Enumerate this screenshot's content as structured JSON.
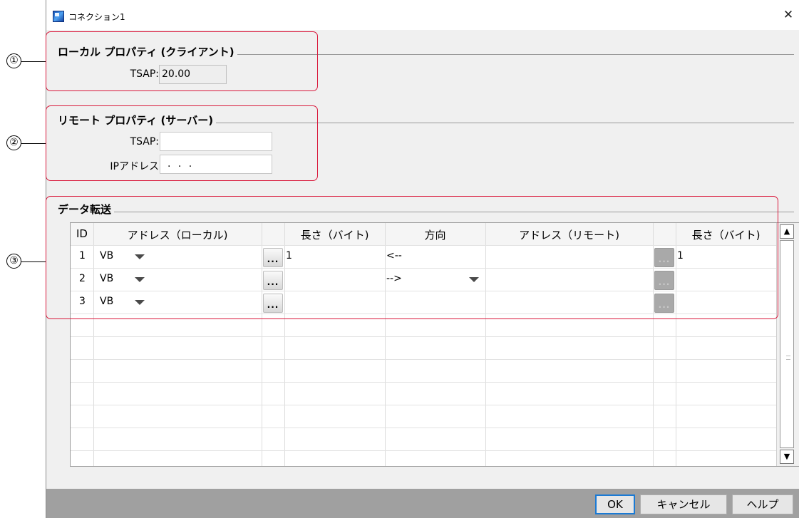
{
  "window": {
    "title": "コネクション1",
    "close_symbol": "✕"
  },
  "callouts": [
    "①",
    "②",
    "③"
  ],
  "local": {
    "group_title": "ローカル プロパティ (クライアント)",
    "tsap_label": "TSAP:",
    "tsap_value": "20.00"
  },
  "remote": {
    "group_title": "リモート プロパティ (サーバー)",
    "tsap_label": "TSAP:",
    "tsap_value": "",
    "ip_label": "IPアドレス",
    "ip_value": " .  .  ."
  },
  "transfer": {
    "group_title": "データ転送",
    "headers": [
      "ID",
      "アドレス（ローカル)",
      "長さ（バイト)",
      "方向",
      "アドレス（リモート)",
      "長さ（バイト)"
    ],
    "rows": [
      {
        "id": "1",
        "address_local": "VB",
        "length_local": "1",
        "direction": "<--",
        "address_remote": "",
        "length_remote": "1"
      },
      {
        "id": "2",
        "address_local": "VB",
        "length_local": "",
        "direction": "-->",
        "address_remote": "",
        "length_remote": ""
      },
      {
        "id": "3",
        "address_local": "VB",
        "length_local": "",
        "direction": "",
        "address_remote": "",
        "length_remote": ""
      }
    ],
    "dots_label": "...",
    "scroll_up": "▲",
    "scroll_down": "▼"
  },
  "footer": {
    "ok": "OK",
    "cancel": "キャンセル",
    "help": "ヘルプ"
  },
  "colors": {
    "highlight": "#d9183b",
    "default_button_border": "#1a7ad4",
    "footer_bar": "#a0a0a0"
  }
}
